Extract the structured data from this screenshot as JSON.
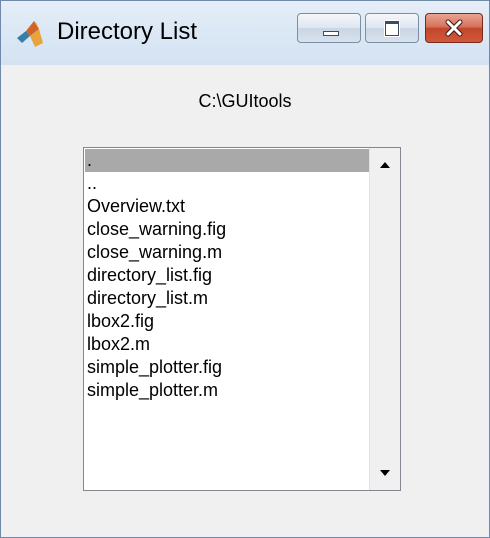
{
  "window": {
    "title": "Directory List",
    "icon": "matlab-logo-icon",
    "controls": {
      "minimize": "minimize-icon",
      "maximize": "maximize-icon",
      "close": "close-icon"
    }
  },
  "main": {
    "path_label": "C:\\GUItools",
    "listbox": {
      "selected_index": 0,
      "items": [
        ".",
        "..",
        "Overview.txt",
        "close_warning.fig",
        "close_warning.m",
        "directory_list.fig",
        "directory_list.m",
        "lbox2.fig",
        "lbox2.m",
        "simple_plotter.fig",
        "simple_plotter.m"
      ],
      "scrollbar": {
        "up_icon": "scroll-up-arrow-icon",
        "down_icon": "scroll-down-arrow-icon"
      }
    }
  },
  "colors": {
    "selection": "#a9a9a9",
    "window_background": "#f0f0f0",
    "close_button": "#c2462b"
  }
}
